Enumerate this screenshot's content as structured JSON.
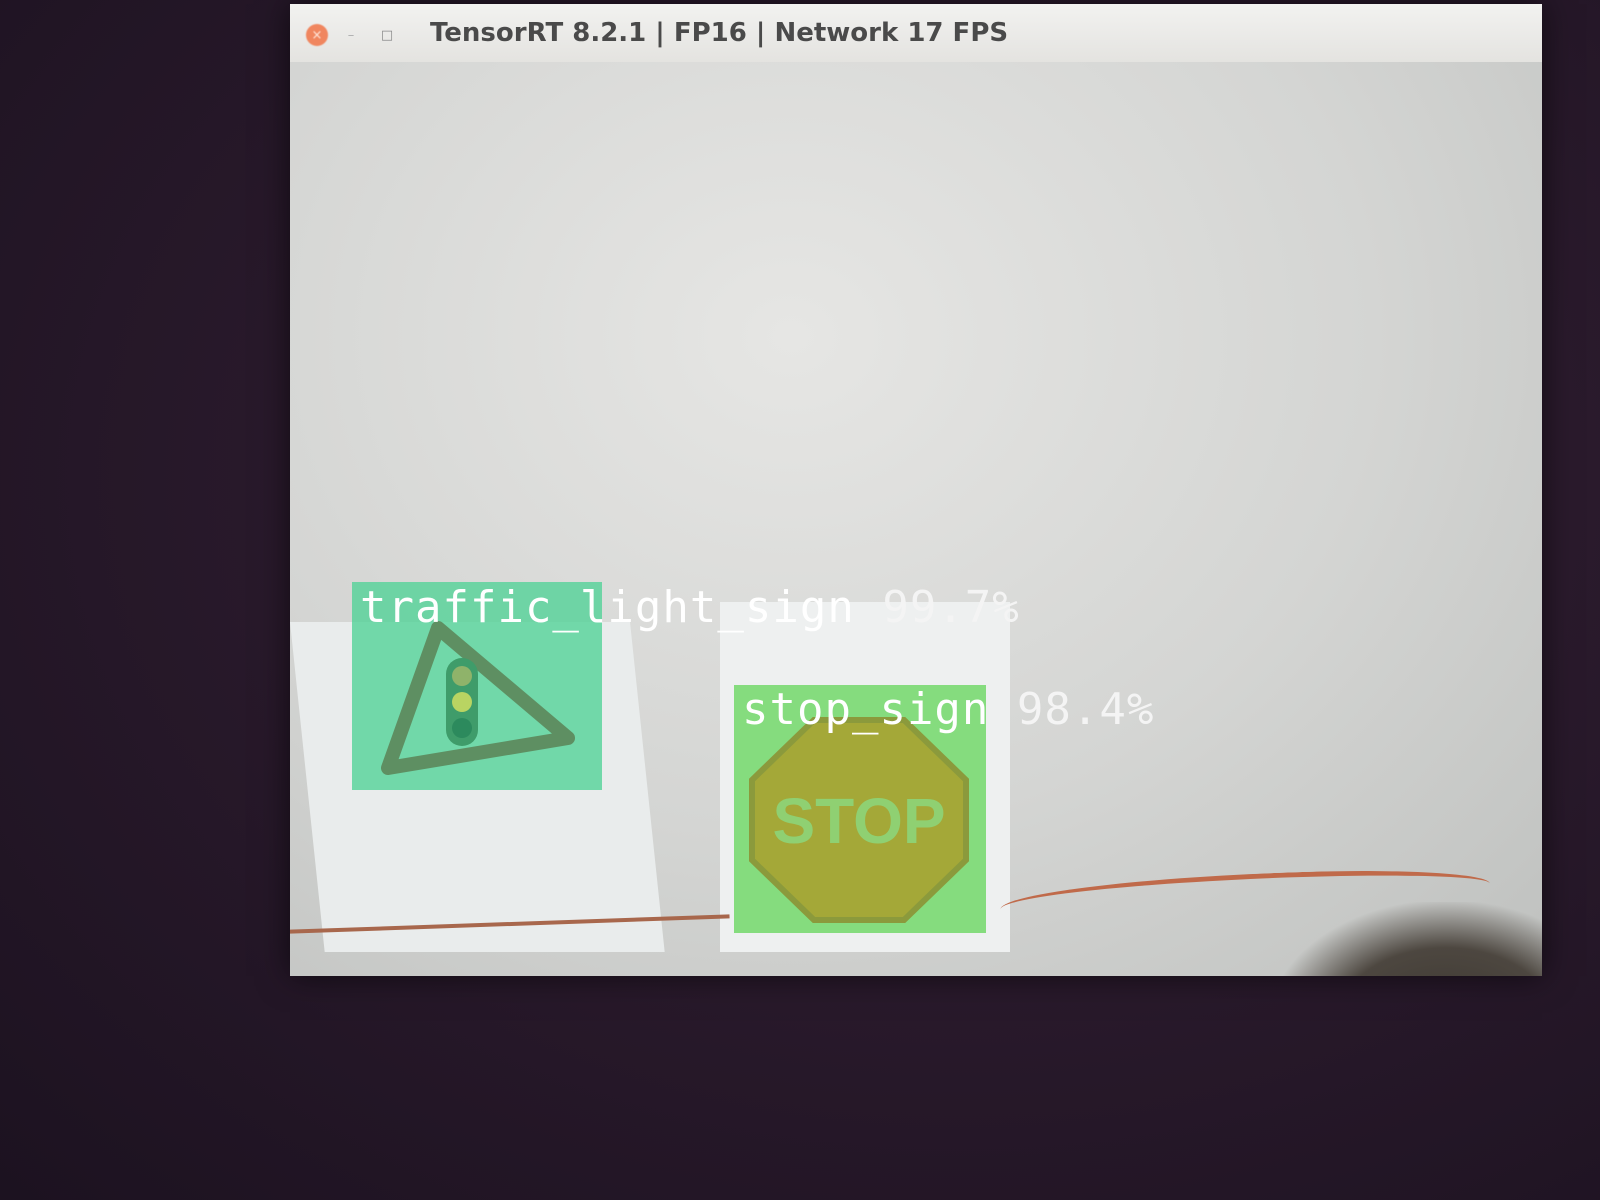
{
  "window": {
    "title": "TensorRT 8.2.1 | FP16 | Network 17 FPS",
    "controls": {
      "close": "×",
      "minimize": "–",
      "maximize": "□"
    }
  },
  "detections": [
    {
      "class": "traffic_light_sign",
      "confidence": "99.7%",
      "box_color": "#50d296",
      "icon": "traffic-light-warning-sign"
    },
    {
      "class": "stop_sign",
      "confidence": "98.4%",
      "box_color": "#6ed764",
      "icon": "stop-sign",
      "sign_text": "STOP"
    }
  ]
}
